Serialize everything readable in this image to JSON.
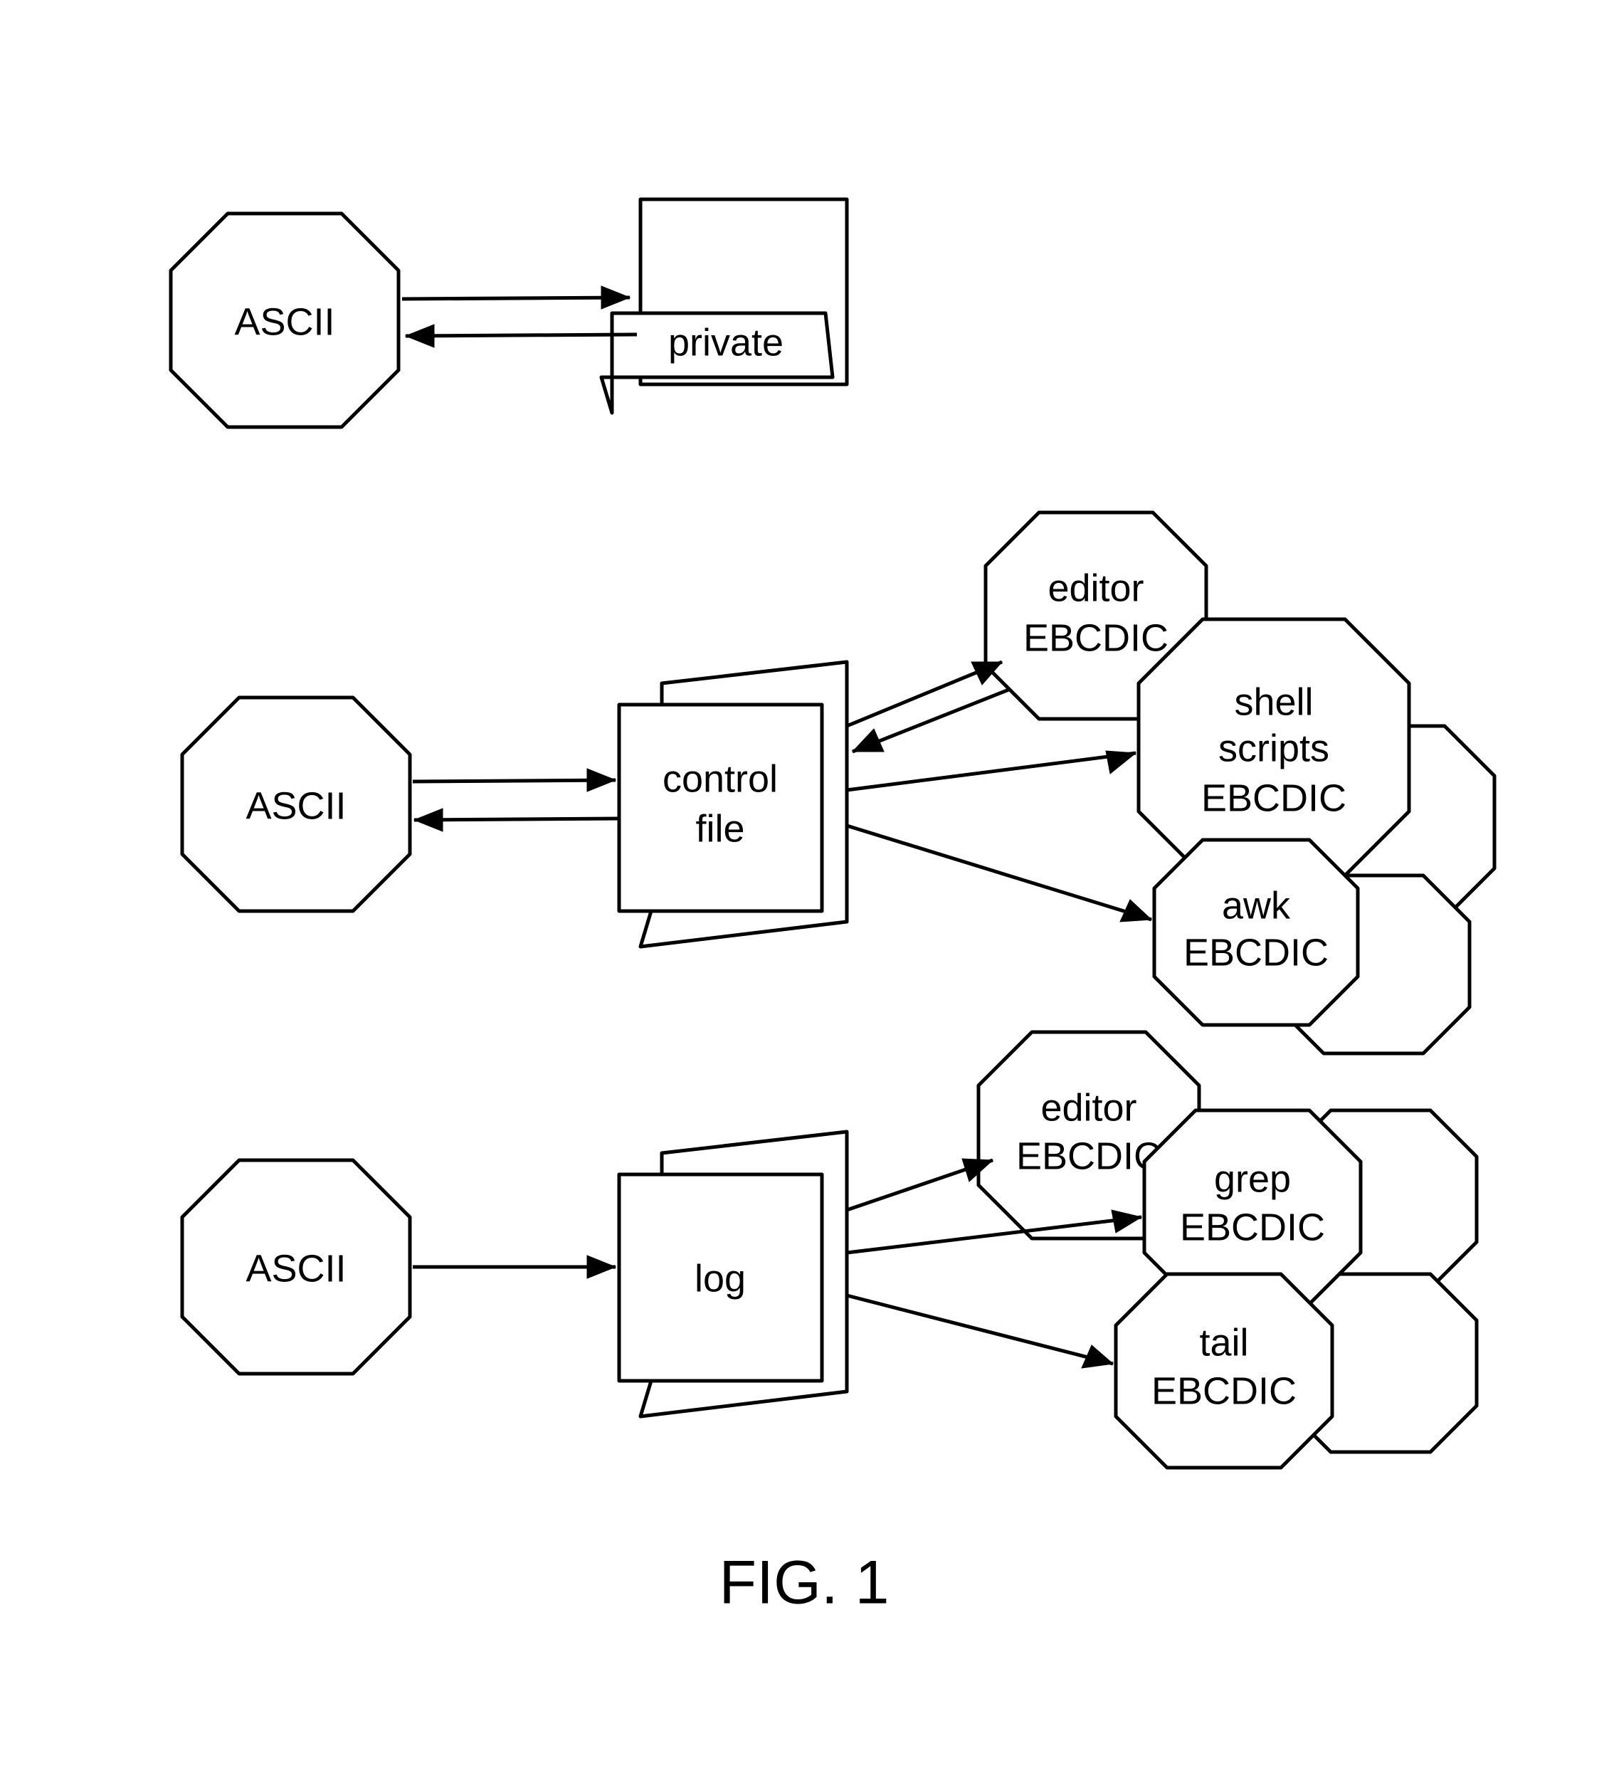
{
  "title": "FIG. 1",
  "rows": {
    "r1": {
      "source": "ASCII",
      "file": "private"
    },
    "r2": {
      "source": "ASCII",
      "file_line1": "control",
      "file_line2": "file",
      "targets": {
        "t1_line1": "editor",
        "t1_line2": "EBCDIC",
        "t2_line1": "shell",
        "t2_line2": "scripts",
        "t2_line3": "EBCDIC",
        "t3_line1": "awk",
        "t3_line2": "EBCDIC"
      }
    },
    "r3": {
      "source": "ASCII",
      "file": "log",
      "targets": {
        "t1_line1": "editor",
        "t1_line2": "EBCDIC",
        "t2_line1": "grep",
        "t2_line2": "EBCDIC",
        "t3_line1": "tail",
        "t3_line2": "EBCDIC"
      }
    }
  }
}
